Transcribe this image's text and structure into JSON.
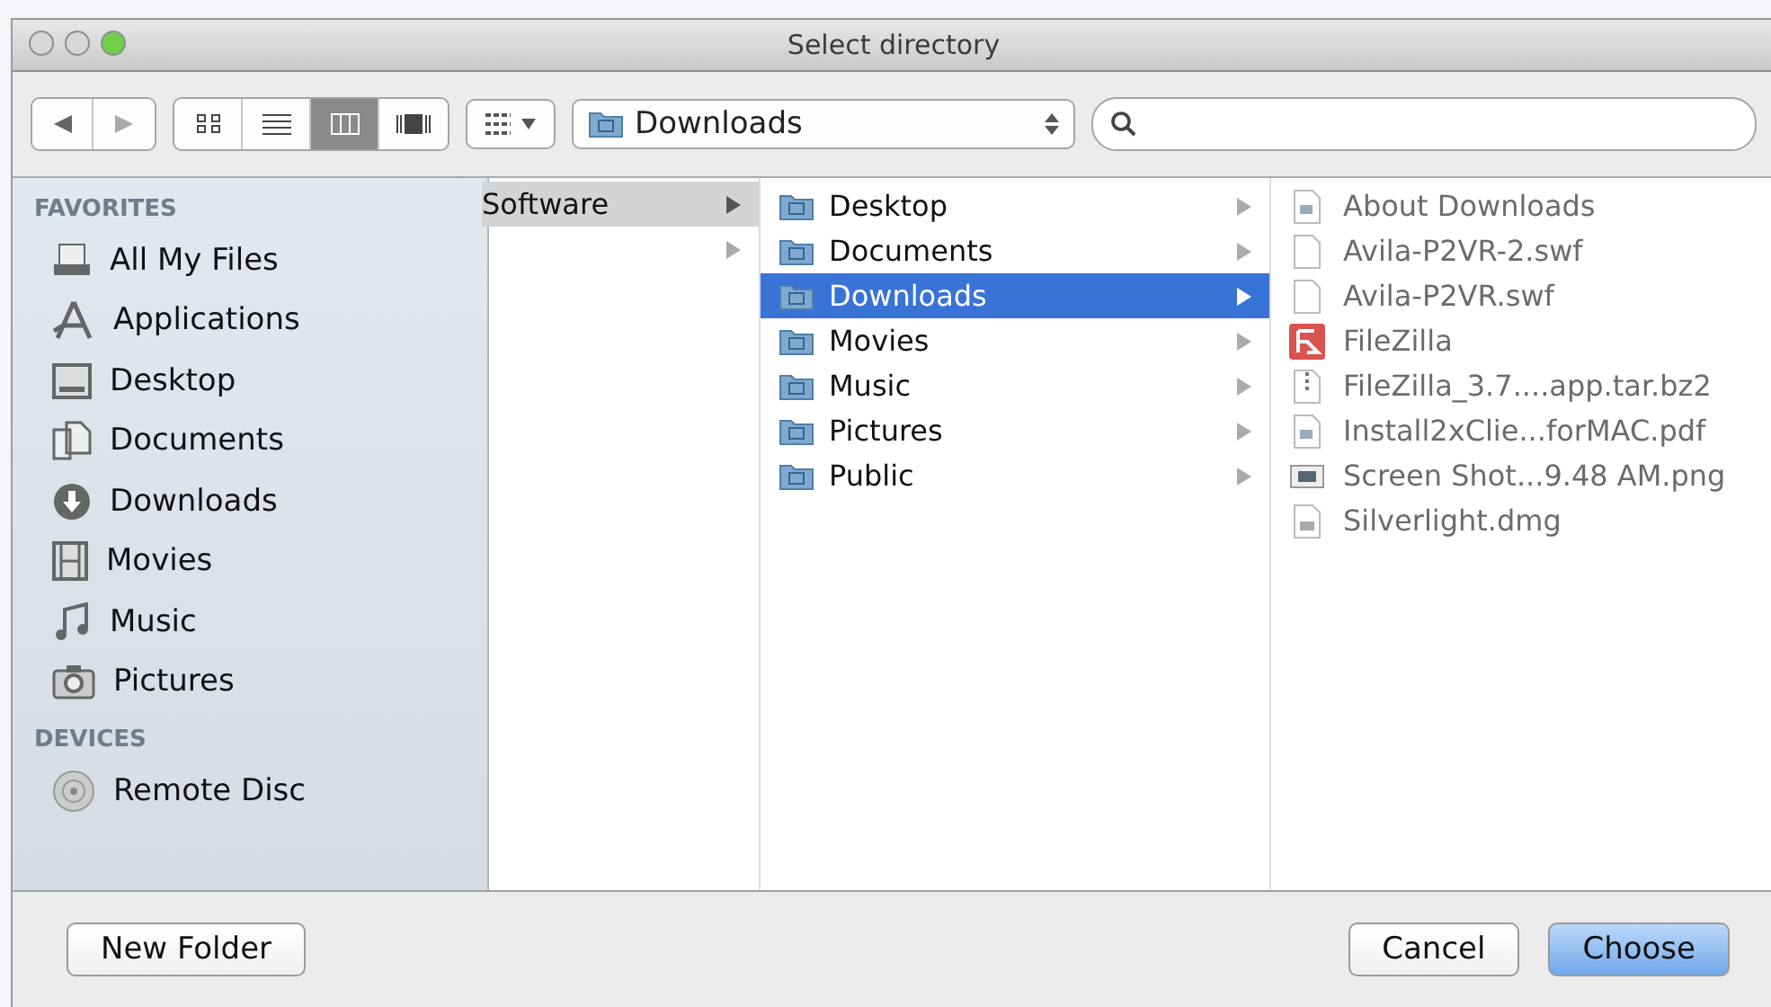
{
  "window": {
    "title": "Select directory"
  },
  "toolbar": {
    "view_modes": [
      {
        "kind": "icons",
        "selected": false
      },
      {
        "kind": "list",
        "selected": false
      },
      {
        "kind": "columns",
        "selected": true
      },
      {
        "kind": "coverflow",
        "selected": false
      }
    ],
    "location": "Downloads"
  },
  "sidebar": {
    "sections": [
      {
        "heading": "FAVORITES",
        "items": [
          {
            "label": "All My Files",
            "kind": "files"
          },
          {
            "label": "Applications",
            "kind": "apps"
          },
          {
            "label": "Desktop",
            "kind": "desktop"
          },
          {
            "label": "Documents",
            "kind": "documents"
          },
          {
            "label": "Downloads",
            "kind": "downloads"
          },
          {
            "label": "Movies",
            "kind": "movies"
          },
          {
            "label": "Music",
            "kind": "music"
          },
          {
            "label": "Pictures",
            "kind": "pictures"
          }
        ]
      },
      {
        "heading": "DEVICES",
        "items": [
          {
            "label": "Remote Disc",
            "kind": "disc"
          }
        ]
      }
    ]
  },
  "columns": [
    {
      "items": [
        {
          "label": "Software",
          "selected": true,
          "active": false
        },
        {
          "selected": false,
          "active": false
        }
      ]
    },
    {
      "items": [
        {
          "label": "Desktop",
          "selected": false,
          "active": false
        },
        {
          "label": "Documents",
          "selected": false,
          "active": false
        },
        {
          "label": "Downloads",
          "selected": true,
          "active": true
        },
        {
          "label": "Movies",
          "selected": false,
          "active": false
        },
        {
          "label": "Music",
          "selected": false,
          "active": false
        },
        {
          "label": "Pictures",
          "selected": false,
          "active": false
        },
        {
          "label": "Public",
          "selected": false,
          "active": false
        }
      ]
    },
    {
      "files": [
        {
          "label": "About Downloads",
          "kind": "document"
        },
        {
          "label": "Avila-P2VR-2.swf",
          "kind": "blank"
        },
        {
          "label": "Avila-P2VR.swf",
          "kind": "blank"
        },
        {
          "label": "FileZilla",
          "kind": "app"
        },
        {
          "label": "FileZilla_3.7....app.tar.bz2",
          "kind": "archive"
        },
        {
          "label": "Install2xClie...forMAC.pdf",
          "kind": "document"
        },
        {
          "label": "Screen Shot...9.48 AM.png",
          "kind": "image"
        },
        {
          "label": "Silverlight.dmg",
          "kind": "disk"
        }
      ]
    }
  ],
  "buttons": {
    "new_folder": "New Folder",
    "cancel": "Cancel",
    "choose": "Choose"
  }
}
